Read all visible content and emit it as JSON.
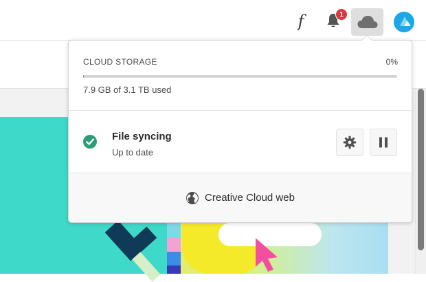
{
  "header": {
    "fonts_glyph": "f",
    "notifications_count": "1",
    "icons": [
      "fonts-icon",
      "bell-icon",
      "cloud-icon",
      "avatar"
    ]
  },
  "cloud_storage": {
    "heading": "CLOUD STORAGE",
    "percent": "0%",
    "used_fraction": 0.0025,
    "used_label": "7.9 GB of 3.1 TB used"
  },
  "sync": {
    "title": "File syncing",
    "status": "Up to date",
    "icons": [
      "check-circle-icon",
      "gear-icon",
      "pause-icon"
    ]
  },
  "footer": {
    "label": "Creative Cloud web",
    "icon": "globe-icon"
  },
  "colors": {
    "check_green": "#2d9d78",
    "badge_red": "#d7373f",
    "teal": "#3ed9c8",
    "avatar_blue": "#1ba8e8"
  }
}
